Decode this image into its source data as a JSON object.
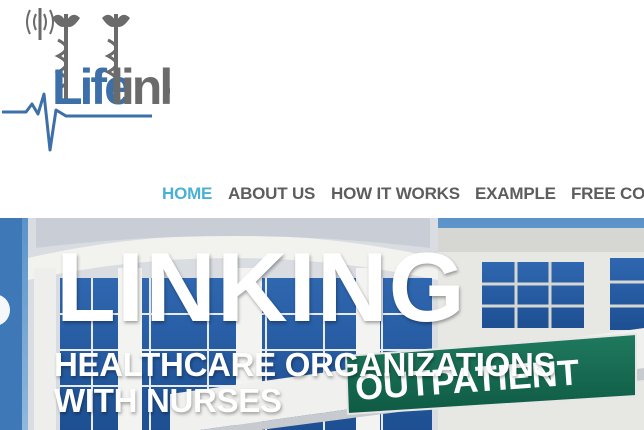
{
  "brand": {
    "logo_text": "LifeLink",
    "colors": {
      "blue": "#3d6fa8",
      "gray": "#6b6b6b"
    }
  },
  "nav": {
    "items": [
      {
        "label": "HOME",
        "active": true
      },
      {
        "label": "ABOUT US",
        "active": false
      },
      {
        "label": "HOW IT WORKS",
        "active": false
      },
      {
        "label": "EXAMPLE",
        "active": false
      },
      {
        "label": "FREE CO",
        "active": false
      }
    ],
    "colors": {
      "active": "#4bb0d6",
      "default": "#5d5d5d"
    }
  },
  "hero": {
    "title": "LINKING",
    "subtitle_line1": "HEALTHCARE ORGANIZATIONS",
    "subtitle_line2": "WITH NURSES",
    "sign_text": "OUTPATIENT"
  }
}
